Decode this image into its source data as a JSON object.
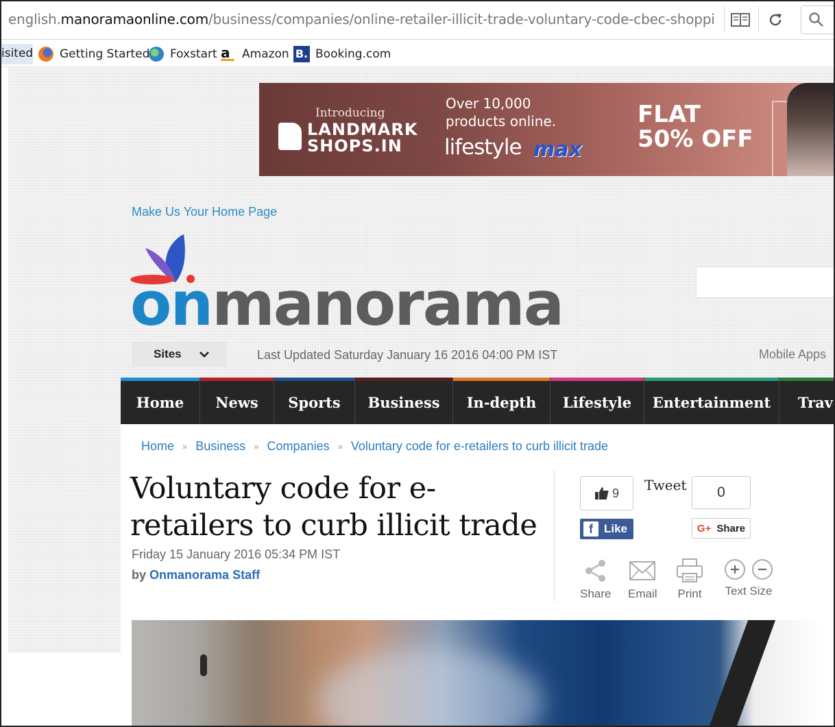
{
  "browser": {
    "url_prefix": "english.",
    "url_domain": "manoramaonline.com",
    "url_path": "/business/companies/online-retailer-illicit-trade-voluntary-code-cbec-shopping-",
    "bookmarks": {
      "visited_label": "isited",
      "items": [
        "Getting Started",
        "Foxstart",
        "Amazon",
        "Booking.com"
      ]
    }
  },
  "ad": {
    "intro": "Introducing",
    "landmark_line1": "LANDMARK",
    "landmark_line2": "SHOPS.IN",
    "over_line1": "Over 10,000",
    "over_line2": "products online.",
    "lifestyle": "lifestyle",
    "max": "max",
    "flat_line1": "FLAT",
    "flat_line2": "50% OFF"
  },
  "header": {
    "make_home": "Make Us Your Home Page",
    "logo_on": "on",
    "logo_rest": "manorama",
    "sites_label": "Sites",
    "last_updated": "Last Updated Saturday January 16 2016 04:00 PM IST",
    "mobile_apps": "Mobile Apps"
  },
  "nav": {
    "items": [
      {
        "label": "Home",
        "color": "#1d8fd0"
      },
      {
        "label": "News",
        "color": "#b3232c"
      },
      {
        "label": "Sports",
        "color": "#1e4f8e"
      },
      {
        "label": "Business",
        "color": "#5a1f1f"
      },
      {
        "label": "In-depth",
        "color": "#e0752a"
      },
      {
        "label": "Lifestyle",
        "color": "#d63a7d"
      },
      {
        "label": "Entertainment",
        "color": "#2a9b7a"
      },
      {
        "label": "Travel",
        "color": "#2f7b3b"
      }
    ]
  },
  "breadcrumb": [
    "Home",
    "Business",
    "Companies",
    "Voluntary code for e-retailers to curb illicit trade"
  ],
  "article": {
    "title": "Voluntary code for e-retailers to curb illicit trade",
    "date": "Friday 15 January 2016 05:34 PM IST",
    "by": "by",
    "author": "Onmanorama Staff"
  },
  "social": {
    "like_count": "9",
    "like_label": "Like",
    "tweet_label": "Tweet",
    "tweet_count": "0",
    "gplus_label": "Share"
  },
  "tools": {
    "share": "Share",
    "email": "Email",
    "print": "Print",
    "text_size": "Text Size"
  }
}
